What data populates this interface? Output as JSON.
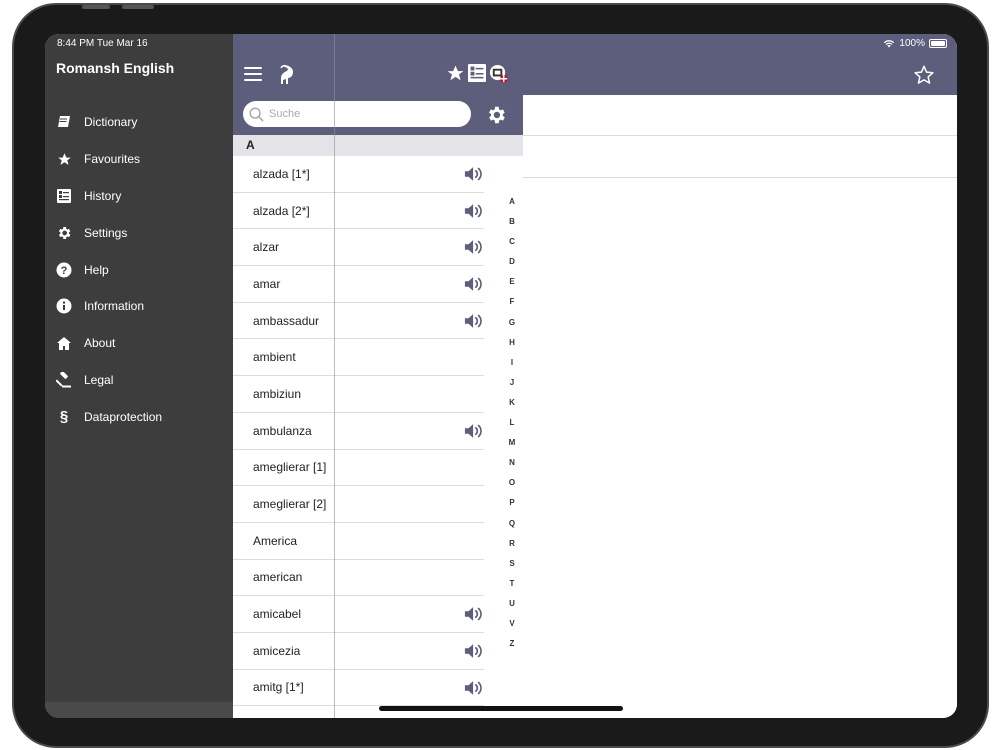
{
  "status": {
    "time": "8:44 PM  Tue Mar 16",
    "battery": "100%"
  },
  "app": {
    "title": "Romansh English"
  },
  "sidebar": {
    "items": [
      {
        "label": "Dictionary",
        "icon": "book-icon"
      },
      {
        "label": "Favourites",
        "icon": "star-icon"
      },
      {
        "label": "History",
        "icon": "history-icon"
      },
      {
        "label": "Settings",
        "icon": "gear-icon"
      },
      {
        "label": "Help",
        "icon": "question-icon"
      },
      {
        "label": "Information",
        "icon": "info-icon"
      },
      {
        "label": "About",
        "icon": "home-icon"
      },
      {
        "label": "Legal",
        "icon": "gavel-icon"
      },
      {
        "label": "Dataprotection",
        "icon": "section-icon"
      }
    ]
  },
  "search": {
    "placeholder": "Suche"
  },
  "list": {
    "section": "A",
    "rows": [
      {
        "label": "alzada [1*]",
        "audio": true
      },
      {
        "label": "alzada [2*]",
        "audio": true
      },
      {
        "label": "alzar",
        "audio": true
      },
      {
        "label": "amar",
        "audio": true
      },
      {
        "label": "ambassadur",
        "audio": true
      },
      {
        "label": "ambient",
        "audio": false
      },
      {
        "label": "ambiziun",
        "audio": false
      },
      {
        "label": "ambulanza",
        "audio": true
      },
      {
        "label": "ameglierar [1]",
        "audio": false
      },
      {
        "label": "ameglierar [2]",
        "audio": false
      },
      {
        "label": "America",
        "audio": false
      },
      {
        "label": "american",
        "audio": false
      },
      {
        "label": "amicabel",
        "audio": true
      },
      {
        "label": "amicezia",
        "audio": true
      },
      {
        "label": "amitg [1*]",
        "audio": true
      }
    ]
  },
  "index": [
    "A",
    "B",
    "C",
    "D",
    "E",
    "F",
    "G",
    "H",
    "I",
    "J",
    "K",
    "L",
    "M",
    "N",
    "O",
    "P",
    "Q",
    "R",
    "S",
    "T",
    "U",
    "V",
    "Z"
  ],
  "colors": {
    "header": "#5c5e7c",
    "sidebar": "#3d3d3d",
    "accent": "#5c5e7c"
  }
}
